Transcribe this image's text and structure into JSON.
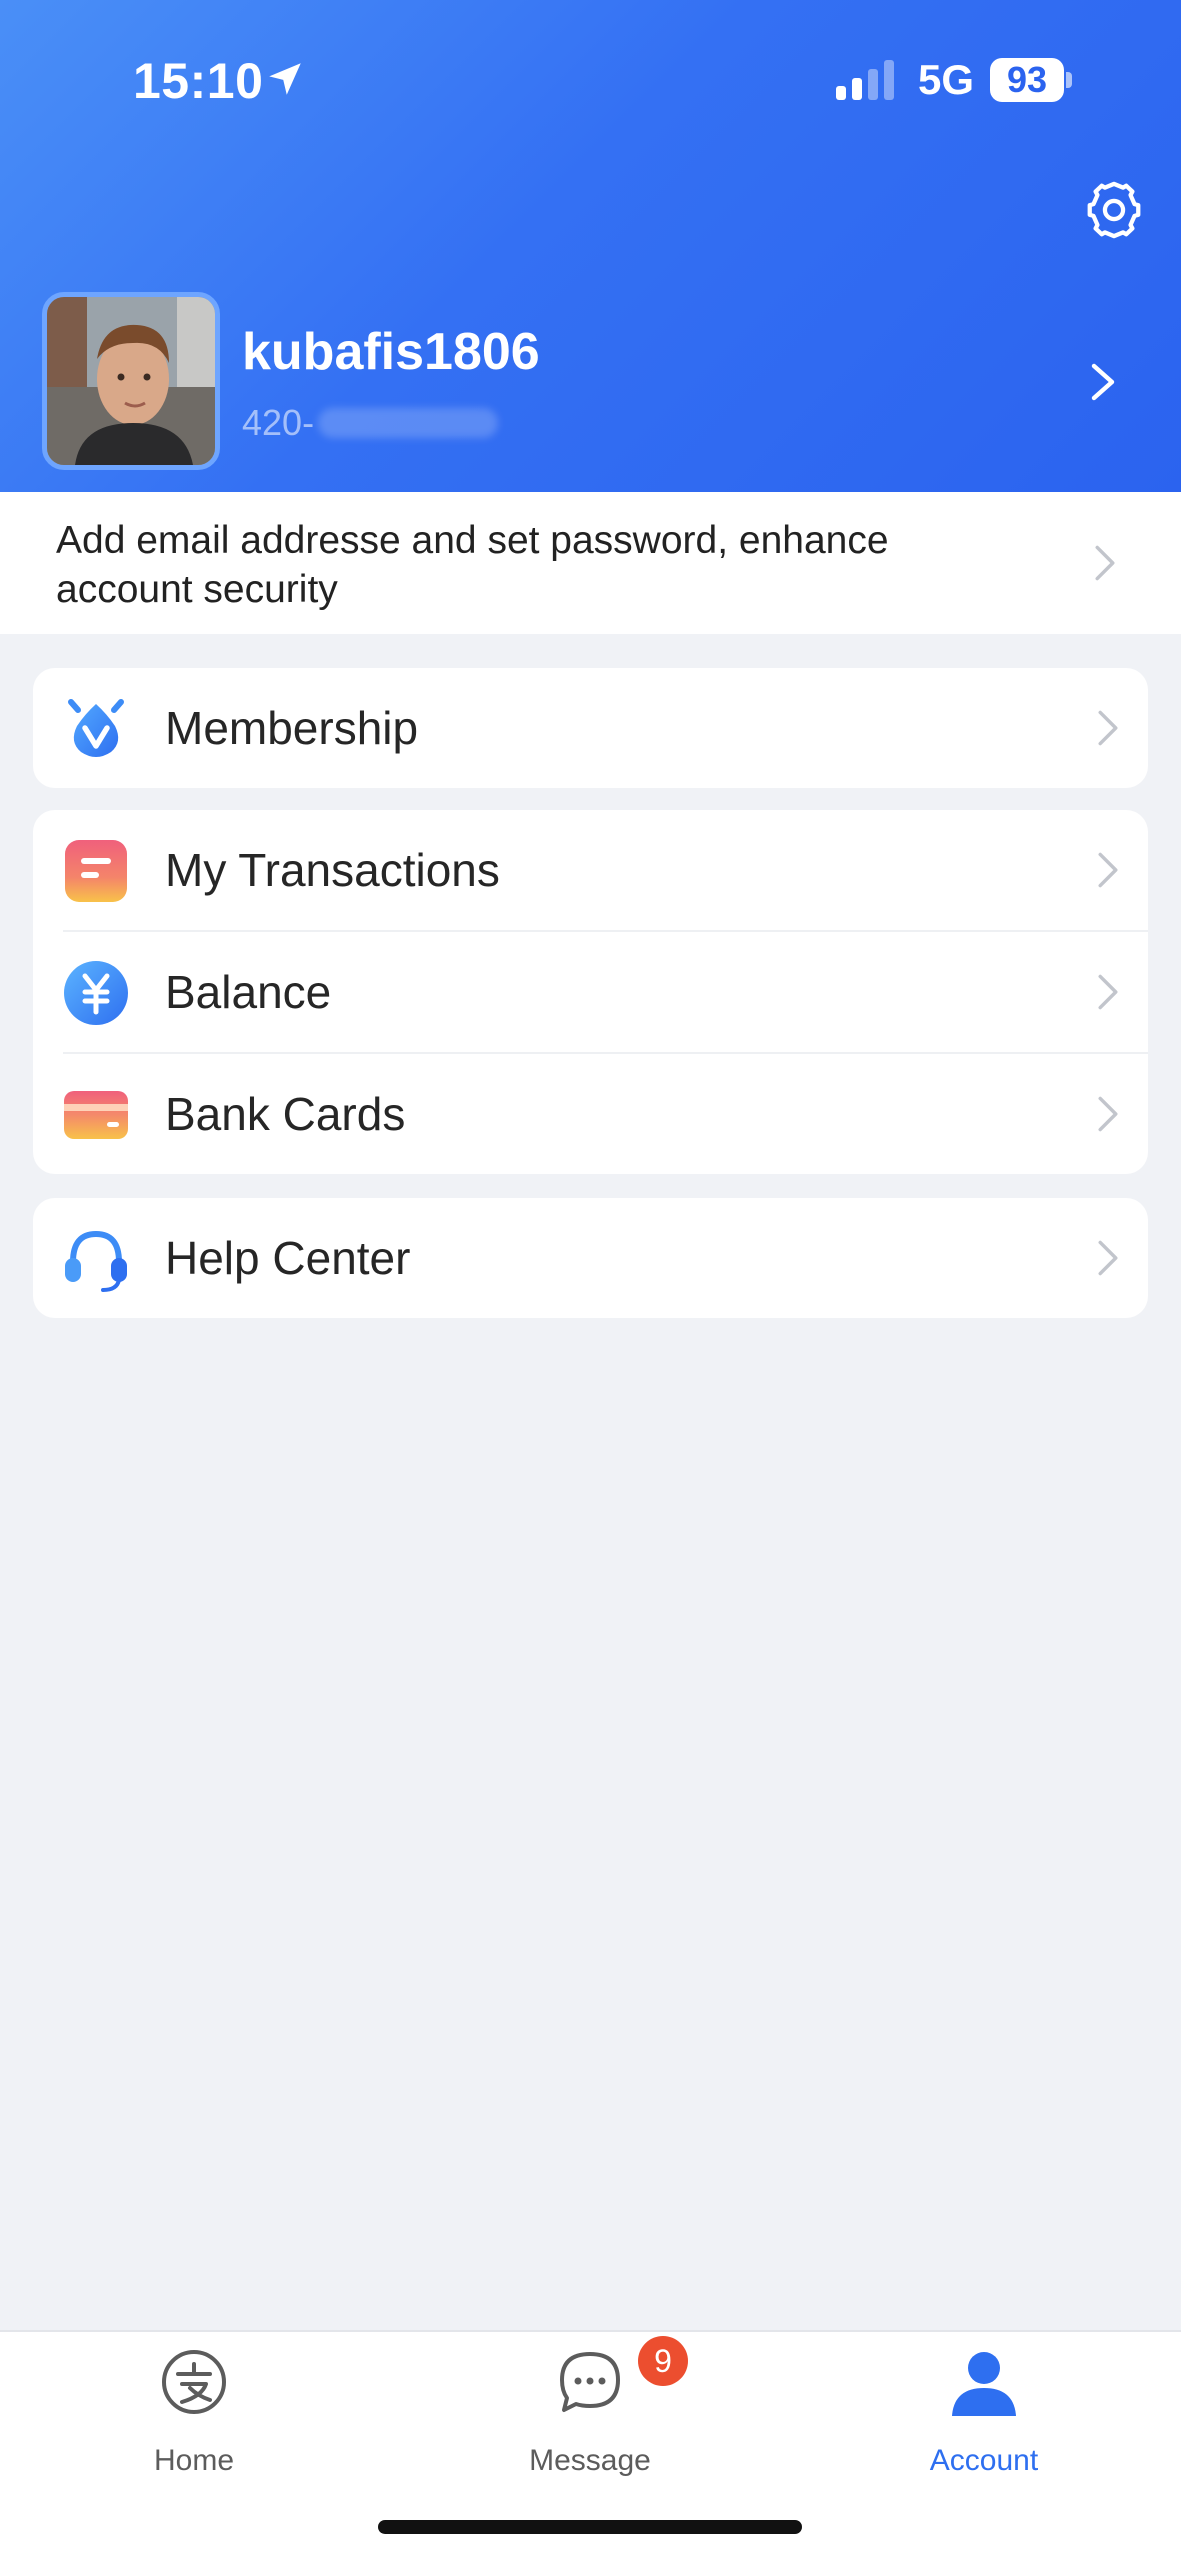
{
  "status_bar": {
    "time": "15:10",
    "network": "5G",
    "battery": "93"
  },
  "header": {
    "settings_icon": "gear-icon",
    "gradient_start": "#4a8ff7",
    "gradient_end": "#2b63ef"
  },
  "profile": {
    "username": "kubafis1806",
    "phone_prefix": "420-"
  },
  "security_banner": {
    "text": "Add email addresse and set password, enhance account security"
  },
  "menu": {
    "membership": {
      "label": "Membership",
      "icon": "membership-v-icon"
    },
    "transactions": {
      "label": "My Transactions",
      "icon": "transactions-icon"
    },
    "balance": {
      "label": "Balance",
      "icon": "yen-coin-icon"
    },
    "bank_cards": {
      "label": "Bank Cards",
      "icon": "bank-card-icon"
    },
    "help_center": {
      "label": "Help Center",
      "icon": "headset-icon"
    }
  },
  "tab_bar": {
    "home": {
      "label": "Home",
      "icon": "alipay-home-icon"
    },
    "message": {
      "label": "Message",
      "icon": "chat-bubble-icon",
      "badge": "9"
    },
    "account": {
      "label": "Account",
      "icon": "person-icon",
      "active": true
    }
  },
  "colors": {
    "accent": "#2e6ff0",
    "badge": "#ec4e2f",
    "background": "#f0f2f6"
  }
}
